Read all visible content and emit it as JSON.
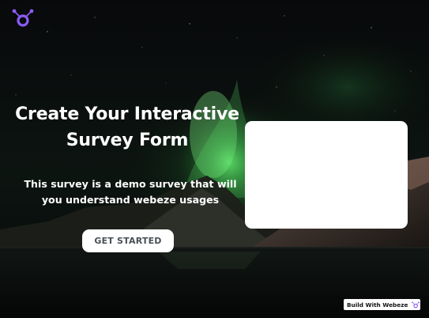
{
  "brand": {
    "logo_icon": "webeze-logo-icon",
    "accent_color": "#7b3ff2"
  },
  "hero": {
    "title": "Create Your Interactive Survey Form",
    "subtitle": "This survey is a demo survey that will you understand webeze usages",
    "cta_label": "GET STARTED",
    "background": "night sky with green aurora over mountains and water"
  },
  "form_card": {
    "content": ""
  },
  "footer_badge": {
    "label": "Build With Webeze",
    "icon": "webeze-logo-icon"
  }
}
